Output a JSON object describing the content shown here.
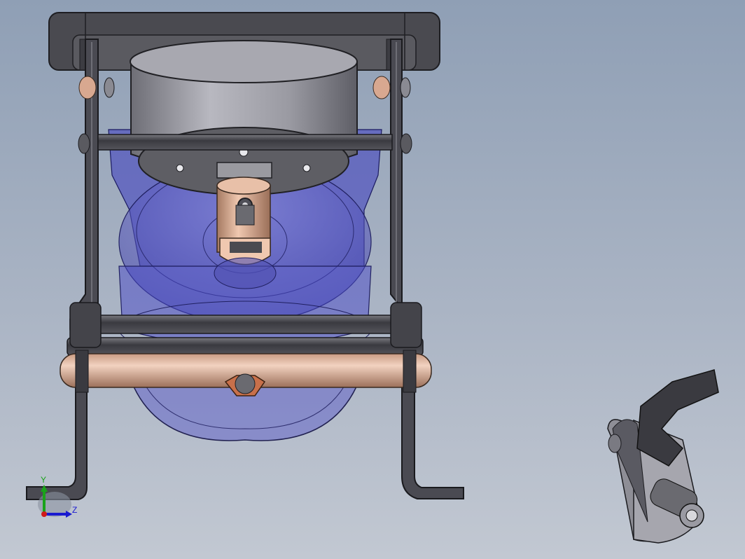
{
  "viewport": {
    "background_top": "#8f9fb5",
    "background_bottom": "#c2c8d2"
  },
  "triad": {
    "y_label": "Y",
    "z_label": "Z",
    "y_color": "#1aa31a",
    "z_color": "#1a1ad0",
    "x_color": "#d01a1a"
  },
  "model": {
    "frame_color": "#4a4a50",
    "cylinder_color": "#9a9aa2",
    "transparent_body_color": "#3a3ac0",
    "bronze_color": "#d8a890",
    "nut_color": "#c8704a"
  },
  "mini_view": {
    "icon": "isometric-preview-icon"
  }
}
